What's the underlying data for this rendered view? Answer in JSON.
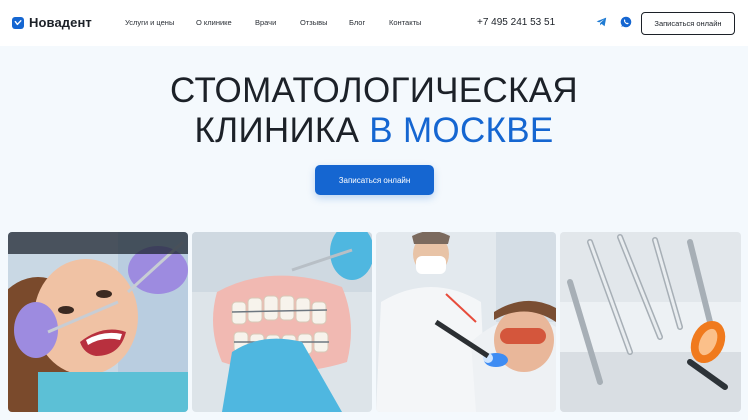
{
  "header": {
    "logo_text": "Новадент",
    "nav": [
      {
        "id": "services",
        "label": "Услуги и цены"
      },
      {
        "id": "about",
        "label": "О клинике"
      },
      {
        "id": "doctors",
        "label": "Врачи"
      },
      {
        "id": "reviews",
        "label": "Отзывы"
      },
      {
        "id": "blog",
        "label": "Блог"
      },
      {
        "id": "contacts",
        "label": "Контакты"
      }
    ],
    "phone": "+7 495 241 53 51",
    "social_icons": [
      "telegram-icon",
      "whatsapp-icon"
    ],
    "cta_label": "Записаться онлайн"
  },
  "hero": {
    "title_line1": "СТОМАТОЛОГИЧЕСКАЯ",
    "title_line2_main": "КЛИНИКА ",
    "title_line2_accent": "В МОСКВЕ",
    "cta_label": "Записаться онлайн"
  },
  "gallery": {
    "photos": [
      "dental-exam-photo",
      "braces-model-photo",
      "uv-curing-photo",
      "dental-equipment-photo"
    ]
  },
  "colors": {
    "accent": "#1566d1",
    "text": "#1c2128",
    "background": "#f4f9fd"
  }
}
